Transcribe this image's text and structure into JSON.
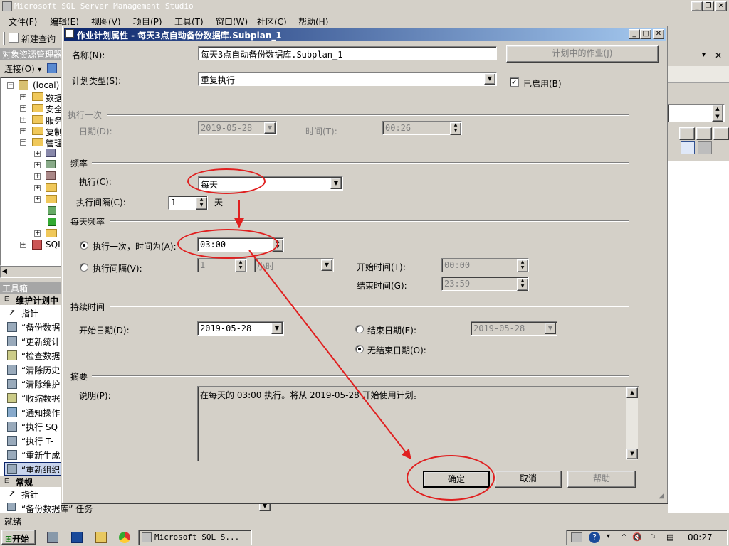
{
  "app": {
    "title": "Microsoft SQL Server Management Studio",
    "menus": [
      "文件(F)",
      "编辑(E)",
      "视图(V)",
      "项目(P)",
      "工具(T)",
      "窗口(W)",
      "社区(C)",
      "帮助(H)"
    ],
    "toolbar_new_query": "新建查询"
  },
  "object_explorer": {
    "title": "对象资源管理器",
    "connect": "连接(O) ▾",
    "root": "(local)",
    "nodes": [
      "数据",
      "安全",
      "服务",
      "复制",
      "管理"
    ],
    "sql_node": "SQL"
  },
  "toolbox": {
    "title": "工具箱",
    "group_maintenance": "维护计划中",
    "pointer": "指针",
    "items": [
      "“备份数据",
      "“更新统计",
      "“检查数据",
      "“清除历史",
      "“清除维护",
      "“收缩数据",
      "“通知操作",
      "“执行 SQ",
      "“执行 T-",
      "“重新生成",
      "“重新组织"
    ],
    "group_general": "常规",
    "general_pointer": "指针",
    "bottom_item": "“备份数据库” 任务"
  },
  "dialog": {
    "title": "作业计划属性 - 每天3点自动备份数据库.Subplan_1",
    "name_label": "名称(N):",
    "name_value": "每天3点自动备份数据库.Subplan_1",
    "jobs_in_schedule": "计划中的作业(J)",
    "schedule_type_label": "计划类型(S):",
    "schedule_type_value": "重复执行",
    "enabled_label": "已启用(B)",
    "enabled_checked": true,
    "one_time": {
      "section": "执行一次",
      "date_label": "日期(D):",
      "date_value": "2019-05-28",
      "time_label": "时间(T):",
      "time_value": "00:26"
    },
    "frequency": {
      "section": "频率",
      "occurs_label": "执行(C):",
      "occurs_value": "每天",
      "recurs_label": "执行间隔(C):",
      "recurs_value": "1",
      "recurs_unit": "天"
    },
    "daily": {
      "section": "每天频率",
      "once_label": "执行一次，时间为(A):",
      "once_value": "03:00",
      "every_label": "执行间隔(V):",
      "every_value": "1",
      "every_unit": "小时",
      "start_time_label": "开始时间(T):",
      "start_time_value": "00:00",
      "end_time_label": "结束时间(G):",
      "end_time_value": "23:59"
    },
    "duration": {
      "section": "持续时间",
      "start_date_label": "开始日期(D):",
      "start_date_value": "2019-05-28",
      "end_date_label": "结束日期(E):",
      "end_date_value": "2019-05-28",
      "no_end_label": "无结束日期(O):"
    },
    "summary": {
      "section": "摘要",
      "desc_label": "说明(P):",
      "desc_value": "在每天的 03:00 执行。将从 2019-05-28 开始使用计划。"
    },
    "ok": "确定",
    "cancel": "取消",
    "help": "帮助"
  },
  "status": {
    "text": "就绪"
  },
  "taskbar": {
    "start": "开始",
    "task": "Microsoft SQL S...",
    "clock": "00:27"
  },
  "annotation_color": "#e02020"
}
